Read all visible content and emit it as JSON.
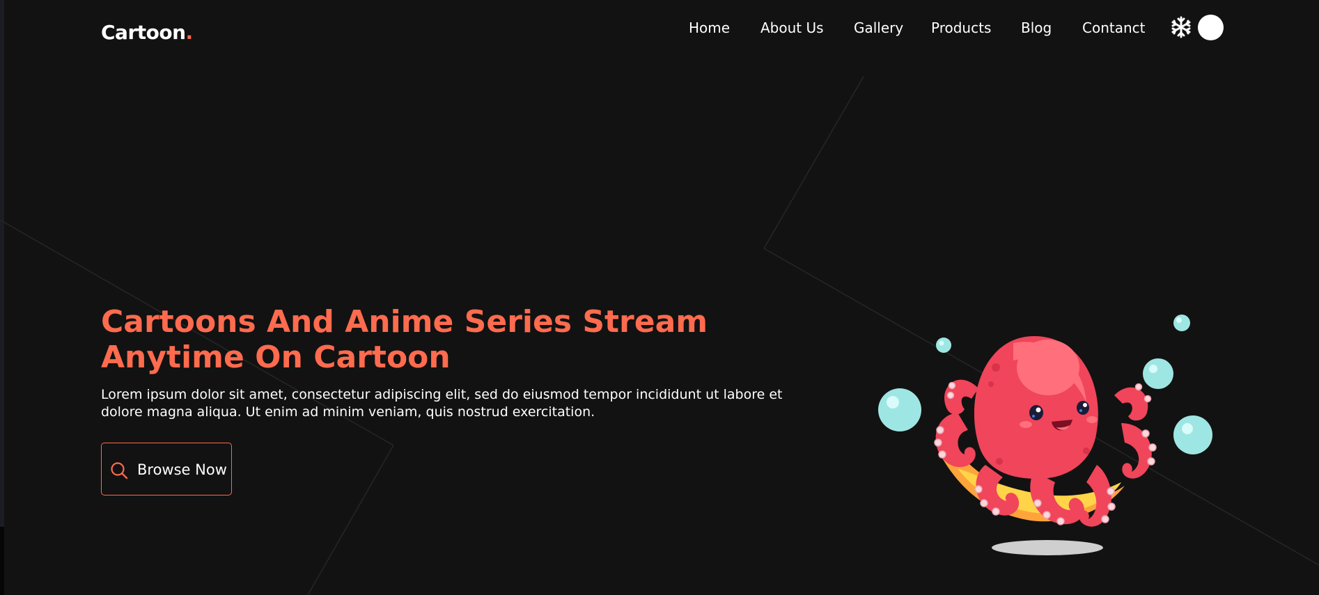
{
  "header": {
    "logo_text": "Cartoon",
    "logo_dot": ".",
    "nav": [
      {
        "label": "Home"
      },
      {
        "label": "About Us"
      },
      {
        "label": "Gallery"
      },
      {
        "label": "Products"
      },
      {
        "label": "Blog"
      },
      {
        "label": "Contanct"
      }
    ],
    "icons": {
      "theme": "snowflake-icon",
      "toggle": "theme-toggle-circle"
    }
  },
  "hero": {
    "title": "Cartoons And Anime Series Stream Anytime On Cartoon",
    "description": "Lorem ipsum dolor sit amet, consectetur adipiscing elit, sed do eiusmod tempor incididunt ut labore et dolore magna aliqua. Ut enim ad minim veniam, quis nostrud exercitation.",
    "cta_label": "Browse Now",
    "cta_icon": "search-icon",
    "illustration": "octopus-illustration"
  },
  "colors": {
    "background": "#121212",
    "accent": "#ff6b4e",
    "text": "#ffffff"
  }
}
